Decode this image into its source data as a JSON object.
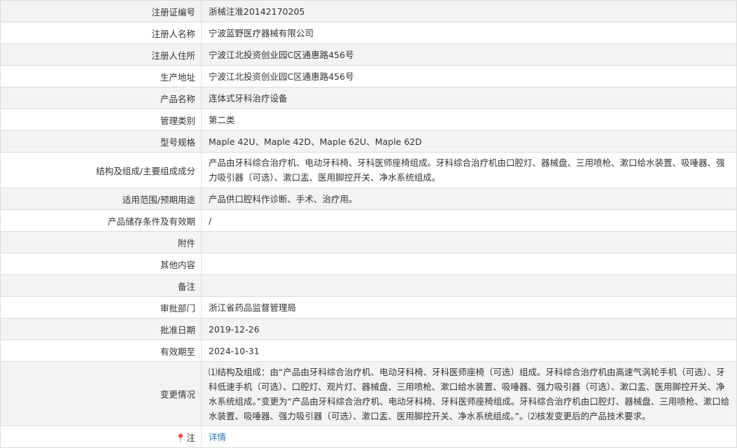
{
  "rows": [
    {
      "label": "注册证编号",
      "value": "浙械注准20142170205"
    },
    {
      "label": "注册人名称",
      "value": "宁波蓝野医疗器械有限公司"
    },
    {
      "label": "注册人住所",
      "value": "宁波江北投资创业园C区通惠路456号"
    },
    {
      "label": "生产地址",
      "value": "宁波江北投资创业园C区通惠路456号"
    },
    {
      "label": "产品名称",
      "value": "连体式牙科治疗设备"
    },
    {
      "label": "管理类别",
      "value": "第二类"
    },
    {
      "label": "型号规格",
      "value": "Maple 42U、Maple 42D、Maple 62U、Maple 62D"
    },
    {
      "label": "结构及组成/主要组成成分",
      "value": "产品由牙科综合治疗机、电动牙科椅、牙科医师座椅组成。牙科综合治疗机由口腔灯、器械盘、三用喷枪、漱口给水装置、吸唾器、强力吸引器（可选）、漱口盂、医用脚控开关、净水系统组成。"
    },
    {
      "label": "适用范围/预期用途",
      "value": "产品供口腔科作诊断、手术、治疗用。"
    },
    {
      "label": "产品储存条件及有效期",
      "value": "/"
    },
    {
      "label": "附件",
      "value": ""
    },
    {
      "label": "其他内容",
      "value": ""
    },
    {
      "label": "备注",
      "value": ""
    },
    {
      "label": "审批部门",
      "value": "浙江省药品监督管理局"
    },
    {
      "label": "批准日期",
      "value": "2019-12-26"
    },
    {
      "label": "有效期至",
      "value": "2024-10-31"
    },
    {
      "label": "变更情况",
      "value": "⑴结构及组成：由“产品由牙科综合治疗机、电动牙科椅、牙科医师座椅（可选）组成。牙科综合治疗机由高速气涡轮手机（可选）、牙科低速手机（可选）、口腔灯、观片灯、器械盘、三用喷枪、漱口给水装置、吸唾器、强力吸引器（可选）、漱口盂、医用脚控开关、净水系统组成。”变更为“产品由牙科综合治疗机、电动牙科椅、牙科医师座椅组成。牙科综合治疗机由口腔灯、器械盘、三用喷枪、漱口给水装置、吸唾器、强力吸引器（可选）、漱口盂、医用脚控开关、净水系统组成。”。⑵核发变更后的产品技术要求。"
    }
  ],
  "note": {
    "label": "注",
    "icon": "pin-icon",
    "link_text": "详情"
  }
}
